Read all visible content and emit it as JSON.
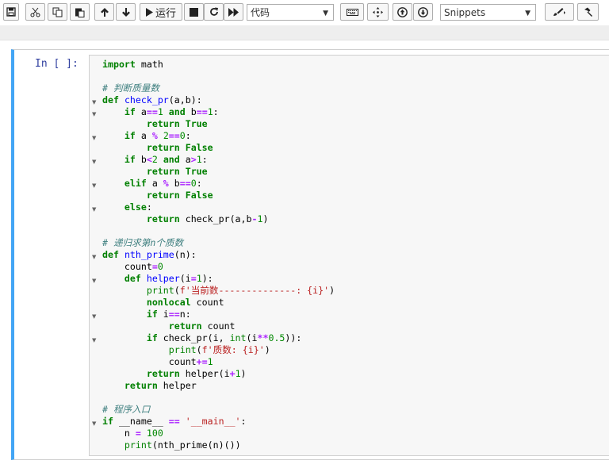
{
  "toolbar": {
    "run_label": "运行",
    "cell_type": "代码",
    "snippets": "Snippets"
  },
  "cell": {
    "prompt": "In [ ]:",
    "lines": [
      "import math",
      "",
      "# 判断质量数",
      "def check_pr(a,b):",
      "    if a==1 and b==1:",
      "        return True",
      "    if a % 2==0:",
      "        return False",
      "    if b<2 and a>1:",
      "        return True",
      "    elif a % b==0:",
      "        return False",
      "    else:",
      "        return check_pr(a,b-1)",
      "",
      "# 递归求第n个质数",
      "def nth_prime(n):",
      "    count=0",
      "    def helper(i=1):",
      "        print(f'当前数--------------: {i}')",
      "        nonlocal count",
      "        if i==n:",
      "            return count",
      "        if check_pr(i, int(i**0.5)):",
      "            print(f'质数: {i}')",
      "            count+=1",
      "        return helper(i+1)",
      "    return helper",
      "",
      "# 程序入口",
      "if __name__ == '__main__':",
      "    n = 100",
      "    print(nth_prime(n)())"
    ]
  },
  "icons": [
    "save-icon",
    "cut-icon",
    "copy-icon",
    "paste-icon",
    "move-up-icon",
    "move-down-icon",
    "play-icon",
    "stop-icon",
    "restart-icon",
    "fast-forward-icon",
    "keyboard-icon",
    "move-icon",
    "circle-arrow-up-icon",
    "circle-arrow-down-icon",
    "brush-icon",
    "hammer-icon"
  ]
}
